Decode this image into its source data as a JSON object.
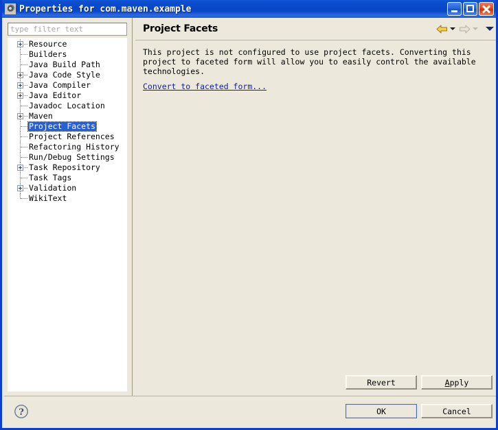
{
  "window": {
    "title": "Properties for com.maven.example",
    "icon": "properties-gear-icon",
    "controls": {
      "minimize": "Minimize",
      "maximize": "Maximize",
      "close": "Close"
    },
    "accent_title_color": "#0a46c8",
    "background_color": "#ece9dc"
  },
  "filter": {
    "placeholder": "type filter text",
    "value": ""
  },
  "tree": {
    "selected": "Project Facets",
    "items": [
      {
        "label": "Resource",
        "expandable": true
      },
      {
        "label": "Builders",
        "expandable": false
      },
      {
        "label": "Java Build Path",
        "expandable": false
      },
      {
        "label": "Java Code Style",
        "expandable": true
      },
      {
        "label": "Java Compiler",
        "expandable": true
      },
      {
        "label": "Java Editor",
        "expandable": true
      },
      {
        "label": "Javadoc Location",
        "expandable": false
      },
      {
        "label": "Maven",
        "expandable": true
      },
      {
        "label": "Project Facets",
        "expandable": false
      },
      {
        "label": "Project References",
        "expandable": false
      },
      {
        "label": "Refactoring History",
        "expandable": false
      },
      {
        "label": "Run/Debug Settings",
        "expandable": false
      },
      {
        "label": "Task Repository",
        "expandable": true
      },
      {
        "label": "Task Tags",
        "expandable": false
      },
      {
        "label": "Validation",
        "expandable": true
      },
      {
        "label": "WikiText",
        "expandable": false
      }
    ]
  },
  "page": {
    "title": "Project Facets",
    "description": "This project is not configured to use project facets. Converting this project to faceted form will allow you to easily control the available technologies.",
    "link_label": "Convert to faceted form...",
    "link_color": "#101ea8",
    "nav": {
      "back_icon": "back-arrow-icon",
      "back_enabled": true,
      "back_color": "#f2c94c",
      "forward_icon": "forward-arrow-icon",
      "forward_enabled": false,
      "forward_color": "#d9d6c6",
      "menu_icon": "chevron-down-icon",
      "menu_color": "#1b2a6b"
    }
  },
  "buttons": {
    "revert": "Revert",
    "apply_prefix": "",
    "apply_mnemonic": "A",
    "apply_suffix": "pply",
    "ok": "OK",
    "cancel": "Cancel"
  },
  "help": {
    "icon": "help-question-icon",
    "label": "?"
  }
}
